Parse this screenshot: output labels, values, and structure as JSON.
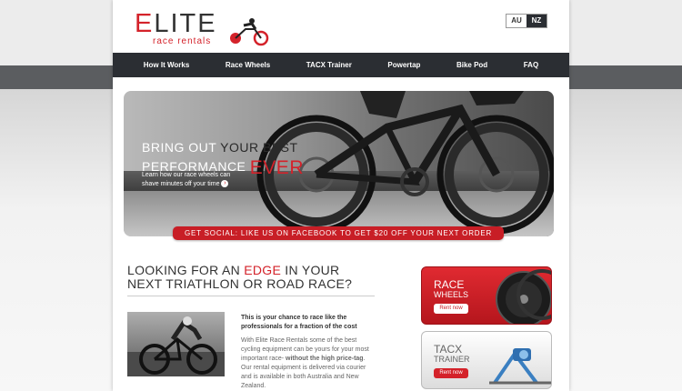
{
  "brand": {
    "name_first": "E",
    "name_rest": "LITE",
    "tagline": "race rentals"
  },
  "lang": {
    "au": "AU",
    "nz": "NZ"
  },
  "nav": [
    "How It Works",
    "Race Wheels",
    "TACX Trainer",
    "Powertap",
    "Bike Pod",
    "FAQ"
  ],
  "hero": {
    "line1_a": "BRING OUT ",
    "line1_b": "YOUR BEST",
    "line2_a": "PERFORMANCE ",
    "line2_b": "EVER",
    "sub": "Learn how our race wheels can shave minutes off your time"
  },
  "promo": "GET SOCIAL: LIKE US ON FACEBOOK TO GET $20 OFF YOUR NEXT ORDER",
  "heading": {
    "a": "LOOKING FOR AN ",
    "b": "EDGE",
    "c": " IN YOUR",
    "d": "NEXT TRIATHLON OR ROAD RACE?"
  },
  "intro": {
    "bold": "This is your chance to race like the professionals for a fraction of the cost",
    "p_a": "With Elite Race Rentals some of the best cycling equipment can be yours for your most important race- ",
    "p_b": "without the high price-tag",
    "p_c": ". Our rental equipment is delivered via courier and is available in both Australia and New Zealand."
  },
  "cards": {
    "race": {
      "t1": "RACE",
      "t2": "WHEELS",
      "btn": "Rent now"
    },
    "tacx": {
      "t1": "TACX",
      "t2": "TRAINER",
      "btn": "Rent now"
    }
  },
  "colors": {
    "accent": "#d4222a",
    "nav": "#2b2e33"
  }
}
